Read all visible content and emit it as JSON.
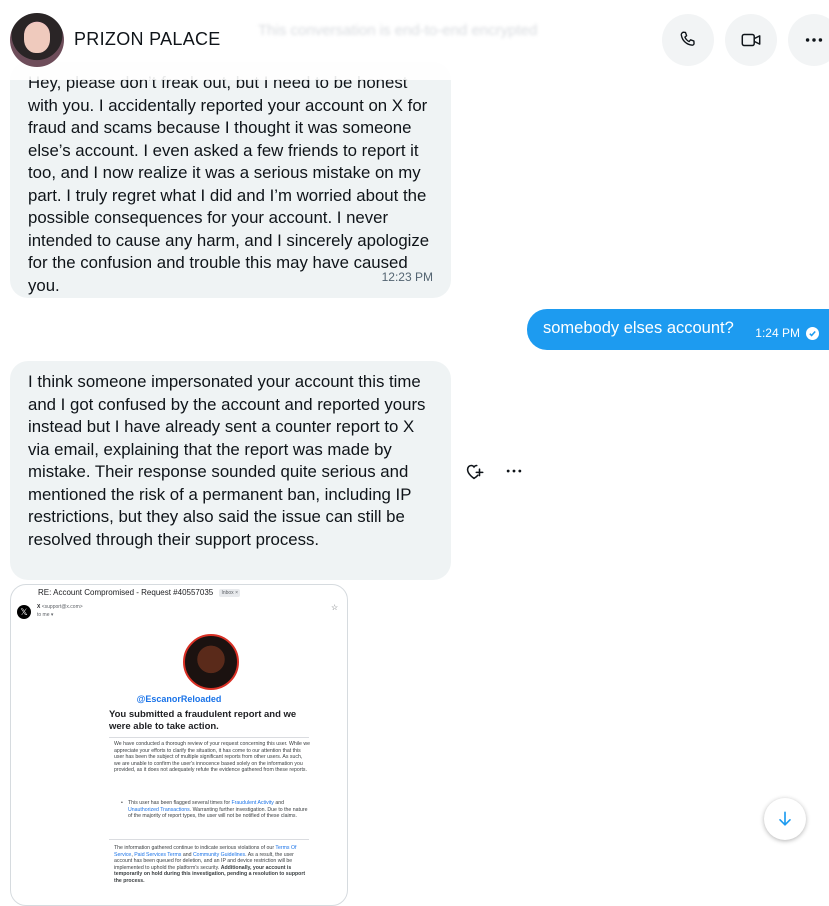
{
  "header": {
    "name": "PRIZON PALACE",
    "faded_text": "This conversation is end-to-end encrypted"
  },
  "messages": {
    "msg1": {
      "text": "Hey, please don’t freak out, but I need to be honest with you. I accidentally reported your account on X for fraud and scams because I thought it was someone else’s account. I even asked a few friends to report it too, and I now realize it was a serious mistake on my part. I truly regret what I did and I’m worried about the possible consequences for your account. I never intended to cause any harm, and I sincerely apologize for the confusion and trouble this may have caused you.",
      "time": "12:23 PM"
    },
    "msg2": {
      "text": "somebody elses account?",
      "time": "1:24 PM"
    },
    "msg3": {
      "text": "I think someone impersonated your account this time and I got confused by the account and reported yours instead but I have already sent a counter report to X via email, explaining that the report was made by mistake. Their response sounded quite serious and mentioned the risk of a permanent ban, including IP restrictions, but they also said the issue can still be resolved through their support process."
    }
  },
  "email": {
    "subject": "RE: Account Compromised - Request #40557035",
    "inbox_tag": "Inbox ×",
    "sender": "X",
    "sender_email": "<support@x.com>",
    "to": "to me ▾",
    "handle": "@EscanorReloaded",
    "headline": "You submitted a fraudulent report and we were able to take action.",
    "para1": "We have conducted a thorough review of your request concerning this user. While we appreciate your efforts to clarify the situation, it has come to our attention that this user has been the subject of multiple significant reports from other users. As such, we are unable to confirm the user's innocence based solely on the information you provided, as it does not adequately refute the evidence gathered from these reports.",
    "bullet_a": "This user has been flagged several times for ",
    "bullet_link1": "Fraudulent Activity",
    "bullet_b": " and ",
    "bullet_link2": "Unauthorized Transactions",
    "bullet_c": ". Warranting further investigation. Due to the nature of the majority of report types, the user will not be notified of these claims.",
    "para2_a": "The information gathered continue to indicate serious violations of our ",
    "link_tos": "Terms Of Service",
    "sep1": ", ",
    "link_pst": "Paid Services Terms",
    "sep2": " and ",
    "link_cg": "Community Guidelines",
    "para2_b": ". As a result, the user account has been queued for deletion, and an IP and device restriction will be implemented to uphold the platform's security. ",
    "para2_bold": "Additionally, your account is temporarily on hold during this investigation, pending a resolution to support the process."
  },
  "icons": {
    "phone": "phone-icon",
    "video": "video-camera-icon",
    "more": "more-horizontal-icon",
    "react": "heart-plus-icon",
    "message_more": "more-horizontal-icon",
    "scroll": "arrow-down-icon",
    "verified": "check-circle-icon"
  },
  "colors": {
    "accent": "#1d9bf0",
    "bubble_in": "#eff3f4",
    "link": "#1a73e8"
  }
}
